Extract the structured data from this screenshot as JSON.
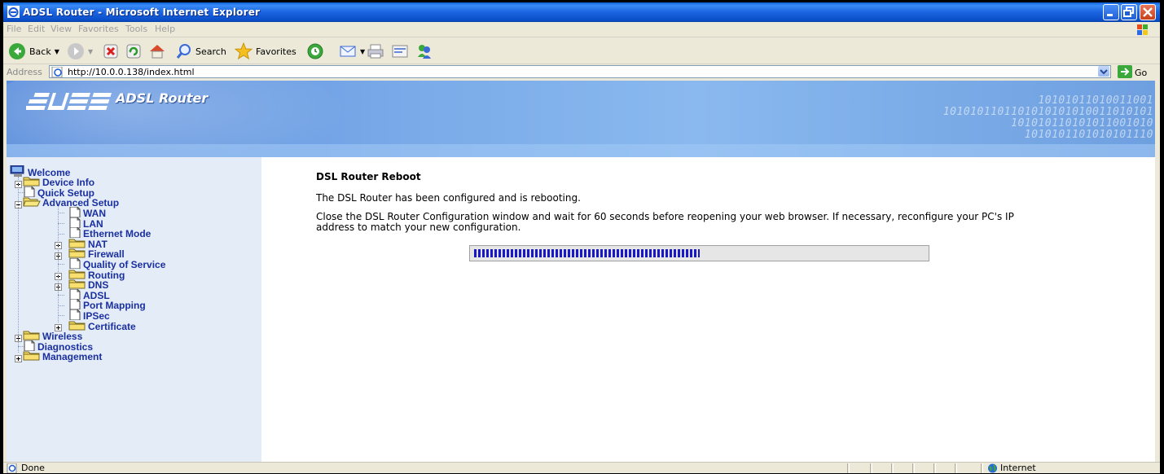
{
  "window": {
    "title": "ADSL Router - Microsoft Internet Explorer",
    "controls": [
      "minimize",
      "maximize",
      "close"
    ]
  },
  "menu": [
    "File",
    "Edit",
    "View",
    "Favorites",
    "Tools",
    "Help"
  ],
  "toolbar": {
    "back_label": "Back",
    "search_label": "Search",
    "favorites_label": "Favorites"
  },
  "address": {
    "label": "Address",
    "url": "http://10.0.0.138/index.html",
    "go_label": "Go"
  },
  "banner": {
    "logo_text": "/ISUS",
    "subtitle": "ADSL Router",
    "binary_lines": [
      "10101011010011001",
      "1010101101101010101010011010101",
      "101010110101011001010",
      "1010101101010101110"
    ]
  },
  "nav": {
    "items": [
      {
        "label": "Welcome",
        "type": "root"
      },
      {
        "label": "Device Info",
        "type": "folder"
      },
      {
        "label": "Quick Setup",
        "type": "page"
      },
      {
        "label": "Advanced Setup",
        "type": "folder-open"
      },
      {
        "label": "WAN",
        "type": "page"
      },
      {
        "label": "LAN",
        "type": "page"
      },
      {
        "label": "Ethernet Mode",
        "type": "page"
      },
      {
        "label": "NAT",
        "type": "folder"
      },
      {
        "label": "Firewall",
        "type": "folder"
      },
      {
        "label": "Quality of Service",
        "type": "page"
      },
      {
        "label": "Routing",
        "type": "folder"
      },
      {
        "label": "DNS",
        "type": "folder"
      },
      {
        "label": "ADSL",
        "type": "page"
      },
      {
        "label": "Port Mapping",
        "type": "page"
      },
      {
        "label": "IPSec",
        "type": "page"
      },
      {
        "label": "Certificate",
        "type": "folder"
      },
      {
        "label": "Wireless",
        "type": "folder"
      },
      {
        "label": "Diagnostics",
        "type": "page"
      },
      {
        "label": "Management",
        "type": "folder"
      }
    ]
  },
  "main": {
    "heading": "DSL Router Reboot",
    "message": "The DSL Router has been configured and is rebooting.",
    "instructions": "Close the DSL Router Configuration window and wait for 60 seconds before reopening your web browser. If necessary, reconfigure your PC's IP address to match your new configuration.",
    "progress_fraction": 0.5
  },
  "status": {
    "text": "Done",
    "zone": "Internet"
  },
  "colors": {
    "nav_text": "#1a2fa0",
    "sidebar_bg": "#e3ecf7",
    "progress": "#1818c8",
    "titlebar": "#0a5fd8"
  }
}
